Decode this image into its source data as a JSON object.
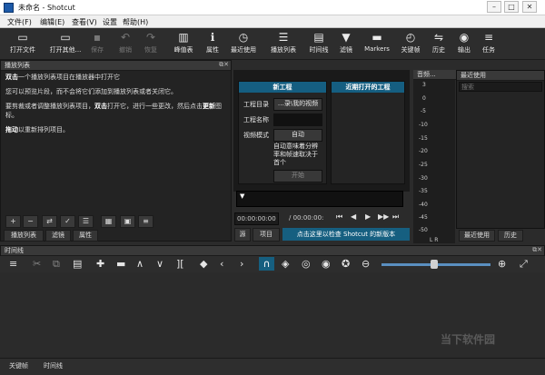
{
  "window": {
    "title": "未命名 - Shotcut",
    "min": "–",
    "max": "□",
    "close": "✕"
  },
  "menu": [
    "文件(F)",
    "编辑(E)",
    "查看(V)",
    "设置",
    "帮助(H)"
  ],
  "toolbar": [
    {
      "label": "打开文件",
      "icon": "▭"
    },
    {
      "label": "打开其他...",
      "icon": "▭"
    },
    {
      "label": "保存",
      "icon": "▪",
      "disabled": true
    },
    {
      "label": "撤销",
      "icon": "↶",
      "disabled": true
    },
    {
      "label": "恢复",
      "icon": "↷",
      "disabled": true
    },
    {
      "label": "峰值表",
      "icon": "▥"
    },
    {
      "label": "属性",
      "icon": "ℹ"
    },
    {
      "label": "最近使用",
      "icon": "◷"
    },
    {
      "label": "播放列表",
      "icon": "☰"
    },
    {
      "label": "时间线",
      "icon": "▤"
    },
    {
      "label": "滤镜",
      "icon": "▼"
    },
    {
      "label": "Markers",
      "icon": "▬"
    },
    {
      "label": "关键帧",
      "icon": "◴"
    },
    {
      "label": "历史",
      "icon": "⇋"
    },
    {
      "label": "输出",
      "icon": "◉"
    },
    {
      "label": "任务",
      "icon": "≡"
    }
  ],
  "playlist": {
    "title": "播放列表",
    "line1_bold": "双击",
    "line1_rest": "一个播放列表项目在播放器中打开它",
    "line2": "您可以预览片段，而不会将它们添加到播放列表或者关闭它。",
    "line3_a": "要剪裁或者调整播放列表项目，",
    "line3_bold": "双击",
    "line3_b": "打开它，进行一些更改，然后点击",
    "line3_bold2": "更新",
    "line3_c": "图标。",
    "line4_bold": "拖动",
    "line4_rest": "以重新排列项目。",
    "tabs": [
      "播放列表",
      "滤镜",
      "属性"
    ]
  },
  "newproject": {
    "title": "新工程",
    "dir_label": "工程目录",
    "dir_value": "…录\\我的视频",
    "name_label": "工程名称",
    "mode_label": "视频模式",
    "mode_value": "自动",
    "description": "自动意味着分辨率和帧速取决于 首个",
    "start": "开始"
  },
  "recent_projects": {
    "title": "近期打开的工程"
  },
  "player": {
    "timecode_current": "00:00:00:00",
    "timecode_total": "/ 00:00:00:",
    "tab_source": "源",
    "tab_project": "项目",
    "update_banner": "点击这里以检查 Shotcut 的新版本"
  },
  "meter": {
    "title": "音频...",
    "ticks": [
      "3",
      "0",
      "-5",
      "-10",
      "-15",
      "-20",
      "-25",
      "-30",
      "-35",
      "-40",
      "-45",
      "-50"
    ],
    "lr": "L R"
  },
  "recent_side": {
    "title": "最近使用",
    "search_placeholder": "搜索",
    "tabs": [
      "最近使用",
      "历史"
    ]
  },
  "timeline": {
    "title": "时间线"
  },
  "bottom_tabs": [
    "关键帧",
    "时间线"
  ],
  "watermark": "当下软件园",
  "colors": {
    "accent": "#155e81",
    "banner": "#165f80",
    "panel": "#232323"
  }
}
